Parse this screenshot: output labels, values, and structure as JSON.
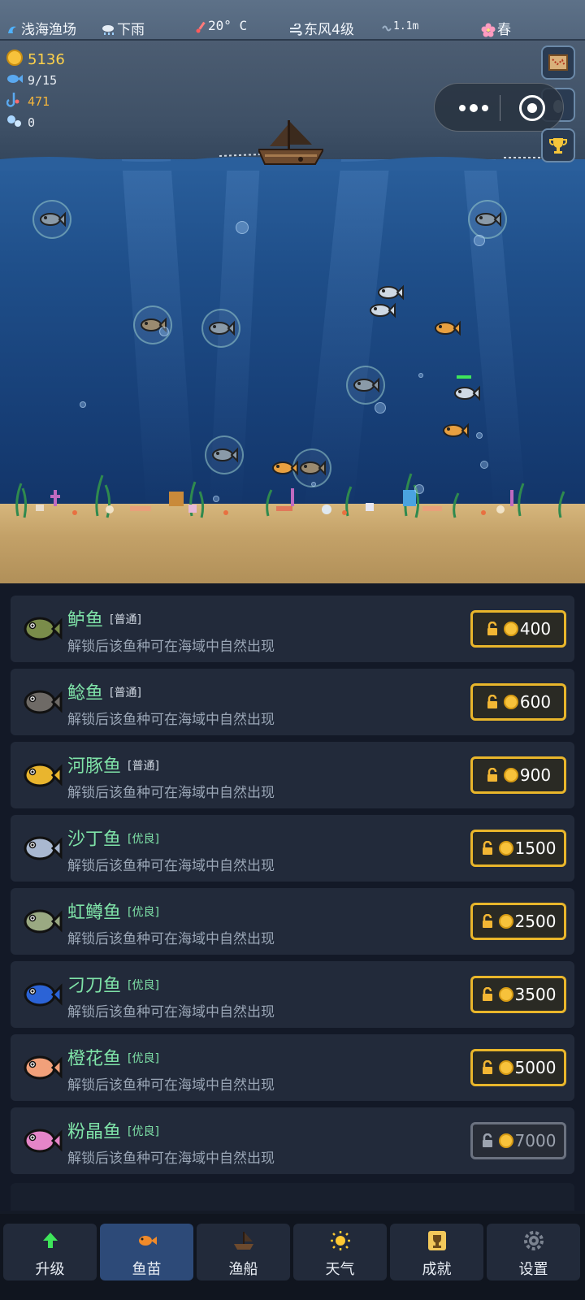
{
  "status_bar": {
    "location": "浅海渔场",
    "weather": "下雨",
    "temperature": "20° C",
    "wind": "东风4级",
    "wave_height": "1.1m",
    "season": "春"
  },
  "stats": {
    "gold": "5136",
    "fish_count": "9/15",
    "bait": "471",
    "bubbles": "0"
  },
  "species": [
    {
      "name": "鲈鱼",
      "rarity": "[普通]",
      "rarity_type": "common",
      "desc": "解锁后该鱼种可在海域中自然出现",
      "price": "400",
      "affordable": true,
      "color": "#7a8c4a"
    },
    {
      "name": "鲶鱼",
      "rarity": "[普通]",
      "rarity_type": "common",
      "desc": "解锁后该鱼种可在海域中自然出现",
      "price": "600",
      "affordable": true,
      "color": "#6e6a66"
    },
    {
      "name": "河豚鱼",
      "rarity": "[普通]",
      "rarity_type": "common",
      "desc": "解锁后该鱼种可在海域中自然出现",
      "price": "900",
      "affordable": true,
      "color": "#e9b52e"
    },
    {
      "name": "沙丁鱼",
      "rarity": "[优良]",
      "rarity_type": "good",
      "desc": "解锁后该鱼种可在海域中自然出现",
      "price": "1500",
      "affordable": true,
      "color": "#a9b8d0"
    },
    {
      "name": "虹鳟鱼",
      "rarity": "[优良]",
      "rarity_type": "good",
      "desc": "解锁后该鱼种可在海域中自然出现",
      "price": "2500",
      "affordable": true,
      "color": "#9aa982"
    },
    {
      "name": "刁刀鱼",
      "rarity": "[优良]",
      "rarity_type": "good",
      "desc": "解锁后该鱼种可在海域中自然出现",
      "price": "3500",
      "affordable": true,
      "color": "#2b63d6"
    },
    {
      "name": "橙花鱼",
      "rarity": "[优良]",
      "rarity_type": "good",
      "desc": "解锁后该鱼种可在海域中自然出现",
      "price": "5000",
      "affordable": true,
      "color": "#f1a07a"
    },
    {
      "name": "粉晶鱼",
      "rarity": "[优良]",
      "rarity_type": "good",
      "desc": "解锁后该鱼种可在海域中自然出现",
      "price": "7000",
      "affordable": false,
      "color": "#e585c8"
    }
  ],
  "nav": [
    {
      "label": "升级",
      "icon": "upgrade-arrow-icon"
    },
    {
      "label": "鱼苗",
      "icon": "fish-fry-icon"
    },
    {
      "label": "渔船",
      "icon": "ship-icon"
    },
    {
      "label": "天气",
      "icon": "sun-icon"
    },
    {
      "label": "成就",
      "icon": "trophy-icon"
    },
    {
      "label": "设置",
      "icon": "gear-icon"
    }
  ],
  "active_tab": "鱼苗",
  "colors": {
    "accent_gold": "#e9b62b",
    "name_green": "#7fe3a8",
    "panel_bg": "#131927",
    "row_bg": "#222a3a"
  }
}
